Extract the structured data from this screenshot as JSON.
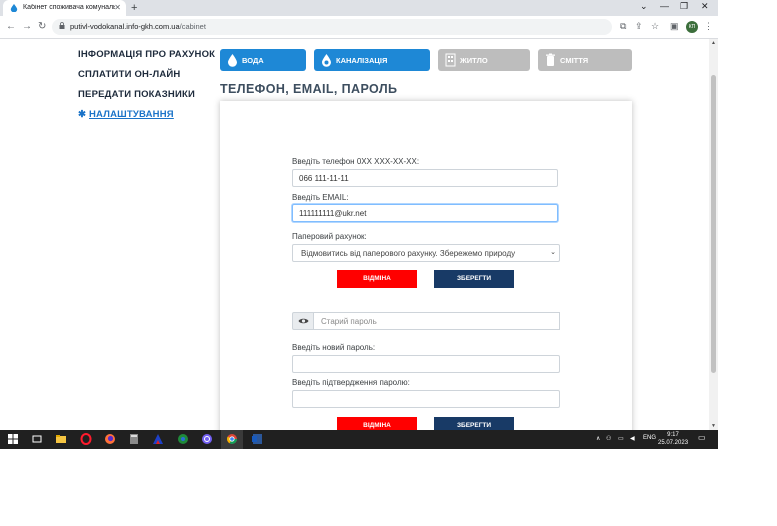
{
  "browser": {
    "tab_title": "Кабінет споживача комунальн",
    "url_domain": "putivl-vodokanal.info-gkh.com.ua",
    "url_path": "/cabinet",
    "profile_initials": "КП"
  },
  "sidebar": {
    "items": [
      {
        "label": "ІНФОРМАЦІЯ ПРО РАХУНОК"
      },
      {
        "label": "СПЛАТИТИ ОН-ЛАЙН"
      },
      {
        "label": "ПЕРЕДАТИ ПОКАЗНИКИ"
      },
      {
        "label": "НАЛАШТУВАННЯ"
      }
    ]
  },
  "services": [
    {
      "label": "ВОДА",
      "icon": "water-drop-icon",
      "active": true
    },
    {
      "label": "КАНАЛІЗАЦІЯ",
      "icon": "sewage-icon",
      "active": true
    },
    {
      "label": "ЖИТЛО",
      "icon": "building-icon",
      "active": false
    },
    {
      "label": "СМІТТЯ",
      "icon": "trash-bin-icon",
      "active": false
    }
  ],
  "page_title": "ТЕЛЕФОН, EMAIL, ПАРОЛЬ",
  "contact_form": {
    "phone_label": "Введіть телефон 0XX XXX-XX-XX:",
    "phone_value": "066 111-11-11",
    "email_label": "Введіть EMAIL:",
    "email_value": "111111111@ukr.net",
    "paper_label": "Паперовий рахунок:",
    "paper_selected": "Відмовитись від паперового рахунку. Збережемо природу",
    "cancel_label": "ВІДМІНА",
    "save_label": "ЗБЕРЕГТИ"
  },
  "password_form": {
    "old_placeholder": "Старий пароль",
    "new_label": "Введіть новий пароль:",
    "confirm_label": "Введіть підтвердження паролю:",
    "cancel_label": "ВІДМІНА",
    "save_label": "ЗБЕРЕГТИ"
  },
  "taskbar": {
    "language": "ENG",
    "time": "9:17",
    "date": "25.07.2023"
  },
  "colors": {
    "accent_blue": "#1e88d6",
    "inactive_gray": "#bdbdbd",
    "cancel_red": "#ff0000",
    "save_navy": "#183a66"
  }
}
